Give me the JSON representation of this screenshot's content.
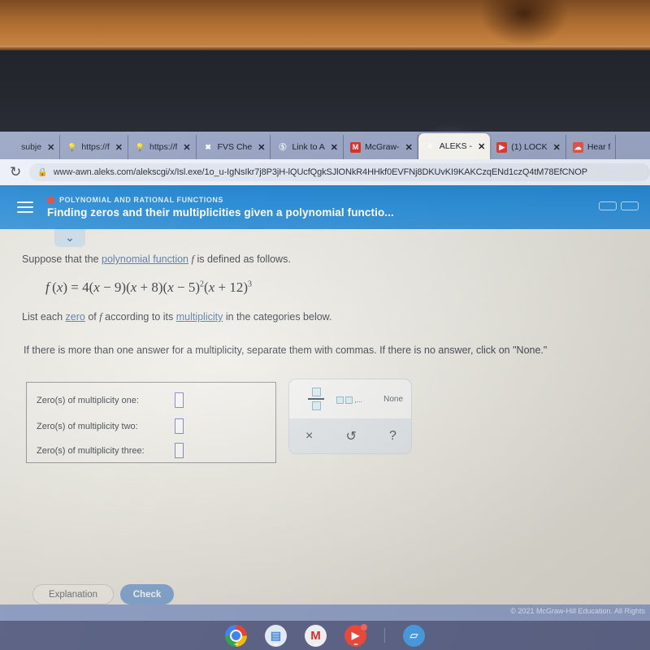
{
  "browser": {
    "reload_icon": "reload-icon",
    "lock_icon": "lock-icon",
    "url": "www-awn.aleks.com/alekscgi/x/Isl.exe/1o_u-IgNsIkr7j8P3jH-lQUcfQgkSJlONkR4HHkf0EVFNj8DKUvKI9KAKCzqENd1czQ4tM78EfCNOP",
    "tabs": [
      {
        "label": "subje",
        "favicon": "blank-icon",
        "close": "✕",
        "active": false
      },
      {
        "label": "https://f",
        "favicon": "bulb-icon",
        "close": "✕",
        "active": false
      },
      {
        "label": "https://f",
        "favicon": "bulb-icon",
        "close": "✕",
        "active": false
      },
      {
        "label": "FVS Che",
        "favicon": "x-mark-icon",
        "close": "✕",
        "active": false
      },
      {
        "label": "Link to A",
        "favicon": "ring-icon",
        "close": "✕",
        "active": false
      },
      {
        "label": "McGraw-",
        "favicon": "mcgraw-icon",
        "close": "✕",
        "active": false
      },
      {
        "label": "ALEKS - ",
        "favicon": "aleks-icon",
        "close": "✕",
        "active": true
      },
      {
        "label": "(1) LOCK",
        "favicon": "youtube-icon",
        "close": "✕",
        "active": false
      },
      {
        "label": "Hear f",
        "favicon": "soundcloud-icon",
        "close": "✕",
        "active": false
      }
    ]
  },
  "app_header": {
    "menu_icon": "hamburger-icon",
    "category_dot": "red-dot-icon",
    "category": "POLYNOMIAL AND RATIONAL FUNCTIONS",
    "title": "Finding zeros and their multiplicities given a polynomial functio...",
    "chevron": "⌄",
    "accent_color": "#2f8fd6"
  },
  "question": {
    "line1_before": "Suppose that the ",
    "line1_link": "polynomial function",
    "line1_var": "f",
    "line1_after": " is defined as follows.",
    "formula": {
      "lhs_f": "f",
      "lhs_x": "x",
      "equals": "=",
      "coefficient": "4",
      "factors": [
        {
          "var": "x",
          "op": "−",
          "num": "9",
          "exp": ""
        },
        {
          "var": "x",
          "op": "+",
          "num": "8",
          "exp": ""
        },
        {
          "var": "x",
          "op": "−",
          "num": "5",
          "exp": "2"
        },
        {
          "var": "x",
          "op": "+",
          "num": "12",
          "exp": "3"
        }
      ],
      "plain": "f(x) = 4(x−9)(x+8)(x−5)²(x+12)³"
    },
    "line2_a": "List each ",
    "line2_link1": "zero",
    "line2_b": " of ",
    "line2_var": "f",
    "line2_c": " according to its ",
    "line2_link2": "multiplicity",
    "line2_d": " in the categories below.",
    "line3": "If there is more than one answer for a multiplicity, separate them with commas. If there is no answer, click on \"None.\""
  },
  "answer_box": {
    "rows": [
      {
        "label": "Zero(s) of multiplicity one:",
        "value": ""
      },
      {
        "label": "Zero(s) of multiplicity two:",
        "value": ""
      },
      {
        "label": "Zero(s) of multiplicity three:",
        "value": ""
      }
    ]
  },
  "keypad": {
    "fraction_button": "fraction-icon",
    "list_button": "list-of-boxes-icon",
    "list_ellipsis": ",...",
    "none_label": "None",
    "clear_icon": "×",
    "undo_icon": "↺",
    "help_icon": "?"
  },
  "footer": {
    "explanation_label": "Explanation",
    "check_label": "Check",
    "copyright": "© 2021 McGraw-Hill Education. All Rights"
  },
  "taskbar": {
    "icons": [
      {
        "name": "chrome-icon",
        "glyph": ""
      },
      {
        "name": "google-docs-icon",
        "glyph": "▤"
      },
      {
        "name": "gmail-icon",
        "glyph": "M"
      },
      {
        "name": "youtube-icon",
        "glyph": "▶"
      },
      {
        "name": "files-icon",
        "glyph": "▱"
      }
    ]
  }
}
